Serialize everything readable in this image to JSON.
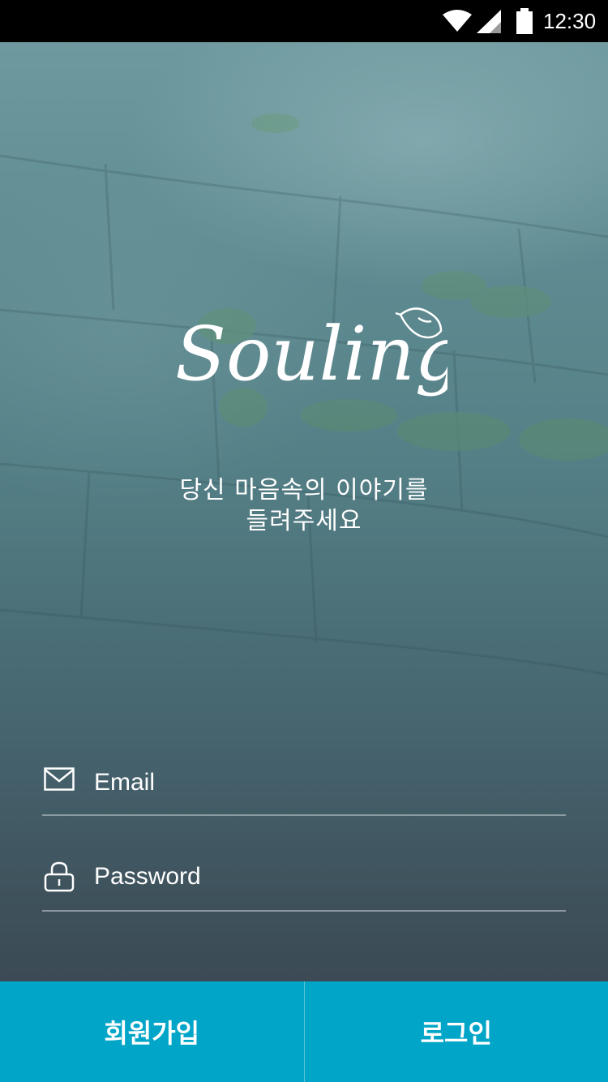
{
  "status_bar": {
    "time": "12:30",
    "icons": [
      "wifi-icon",
      "cell-signal-icon",
      "battery-icon"
    ]
  },
  "app": {
    "logo_text": "Souling",
    "tagline_line1": "당신 마음속의 이야기를",
    "tagline_line2": "들려주세요"
  },
  "form": {
    "email_placeholder": "Email",
    "email_icon": "envelope-icon",
    "password_placeholder": "Password",
    "password_icon": "lock-icon"
  },
  "actions": {
    "signup_label": "회원가입",
    "login_label": "로그인",
    "accent_color": "#00a5c7"
  }
}
